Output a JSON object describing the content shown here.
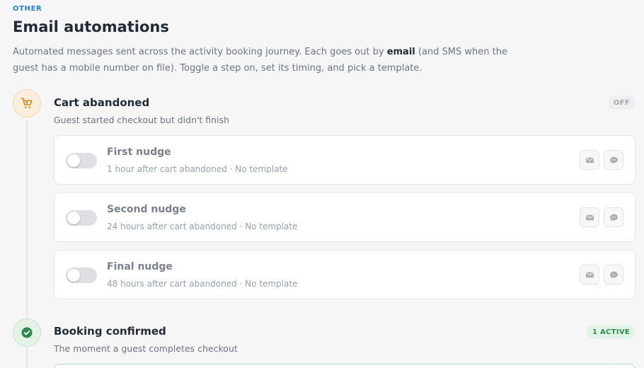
{
  "section": {
    "eyebrow": "OTHER",
    "title": "Email automations",
    "description_before": "Automated messages sent across the activity booking journey. Each goes out by ",
    "description_bold": "email",
    "description_after": " (and SMS when the guest has a mobile number on file). Toggle a step on, set its timing, and pick a template."
  },
  "stages": [
    {
      "title": "Cart abandoned",
      "subtitle": "Guest started checkout but didn't finish",
      "badge": "OFF",
      "icon": "shopping-cart-icon",
      "steps": [
        {
          "title": "First nudge",
          "meta": "1 hour after cart abandoned · No template",
          "enabled": false
        },
        {
          "title": "Second nudge",
          "meta": "24 hours after cart abandoned · No template",
          "enabled": false
        },
        {
          "title": "Final nudge",
          "meta": "48 hours after cart abandoned · No template",
          "enabled": false
        }
      ]
    },
    {
      "title": "Booking confirmed",
      "subtitle": "The moment a guest completes checkout",
      "badge": "1 ACTIVE",
      "icon": "check-circle-icon"
    }
  ],
  "colors": {
    "accent": "#1f7fd6",
    "cart_icon": "#d98a1e",
    "success": "#2f8a4b"
  }
}
